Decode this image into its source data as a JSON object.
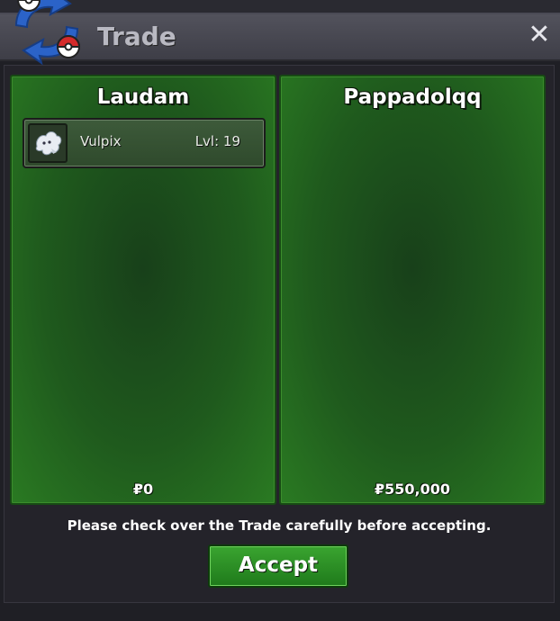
{
  "window": {
    "title": "Trade",
    "close_icon": "close-icon",
    "logo_icon": "trade-swap-icon"
  },
  "panels": [
    {
      "player": "Laudam",
      "items": [
        {
          "icon": "vulpix-sprite-icon",
          "name": "Vulpix",
          "level": "Lvl: 19"
        }
      ],
      "money": "₽0"
    },
    {
      "player": "Pappadolqq",
      "items": [],
      "money": "₽550,000"
    }
  ],
  "notice": "Please check over the Trade carefully before accepting.",
  "accept_label": "Accept",
  "colors": {
    "panel_green": "#1f5a1d",
    "button_green": "#2e9027",
    "titlebar": "#4a4a54"
  }
}
